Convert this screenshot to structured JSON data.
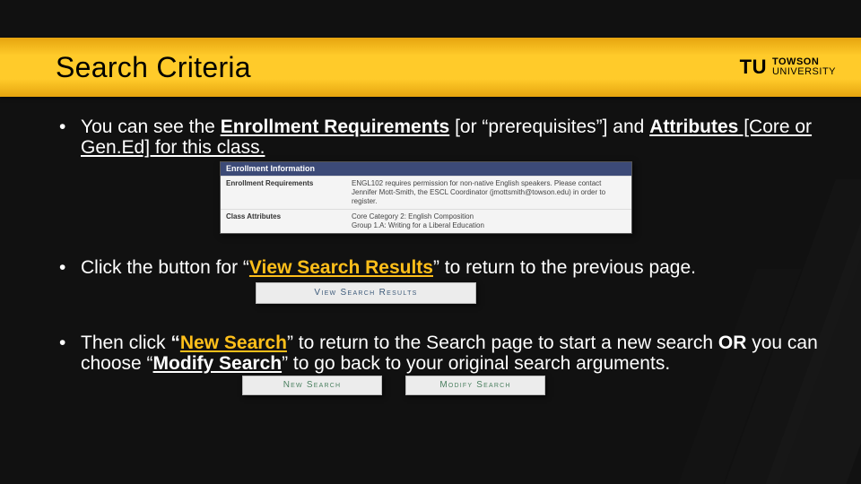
{
  "slide": {
    "title": "Search Criteria",
    "logo": {
      "abbr": "TU",
      "line1": "TOWSON",
      "line2": "UNIVERSITY"
    }
  },
  "bullets": [
    {
      "t1": "You can see the ",
      "b1": "Enrollment Requirements",
      "t2": " [or “prerequisites”] and ",
      "b2": "Attributes",
      "t3": " [Core or Gen.Ed] for this class."
    },
    {
      "t1": "Click the button for “",
      "b1": "View Search Results",
      "t2": "” to return to the previous page."
    },
    {
      "t1": "Then click ",
      "q1": "“",
      "b1": "New Search",
      "t2": "” to return to the Search page to start a new search ",
      "or": "OR",
      "t3": " you can choose “",
      "b2": "Modify Search",
      "t4": "” to go back to your original search arguments."
    }
  ],
  "embed1": {
    "header": "Enrollment Information",
    "rows": [
      {
        "label": "Enrollment Requirements",
        "value": "ENGL102 requires permission for non-native English speakers. Please contact Jennifer Mott-Smith, the ESCL Coordinator (jmottsmith@towson.edu) in order to register."
      },
      {
        "label": "Class Attributes",
        "value": "Core Category 2: English Composition\nGroup 1.A: Writing for a Liberal Education"
      }
    ]
  },
  "embed2": {
    "label": "View Search Results"
  },
  "embed3": {
    "btn1": "New Search",
    "btn2": "Modify Search"
  }
}
